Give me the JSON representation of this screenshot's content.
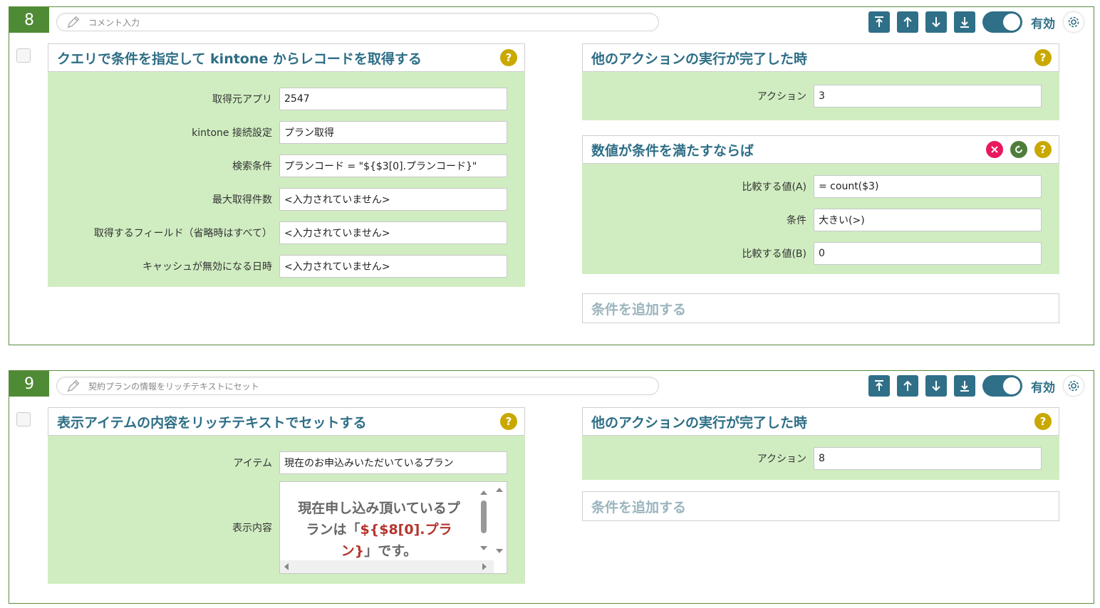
{
  "cards": [
    {
      "number": "8",
      "comment": "コメント入力",
      "status": "有効",
      "left": {
        "title": "クエリで条件を指定して kintone からレコードを取得する",
        "fields": [
          {
            "label": "取得元アプリ",
            "value": "2547"
          },
          {
            "label": "kintone 接続設定",
            "value": "プラン取得"
          },
          {
            "label": "検索条件",
            "value": "プランコード = \"${$3[0].プランコード}\""
          },
          {
            "label": "最大取得件数",
            "value": "<入力されていません>"
          },
          {
            "label": "取得するフィールド（省略時はすべて）",
            "value": "<入力されていません>"
          },
          {
            "label": "キャッシュが無効になる日時",
            "value": "<入力されていません>"
          }
        ]
      },
      "right": {
        "trigger_title": "他のアクションの実行が完了した時",
        "trigger_field": {
          "label": "アクション",
          "value": "3"
        },
        "condition_title": "数値が条件を満たすならば",
        "condition_fields": [
          {
            "label": "比較する値(A)",
            "value": "= count($3)"
          },
          {
            "label": "条件",
            "value": "大きい(>)"
          },
          {
            "label": "比較する値(B)",
            "value": "0"
          }
        ],
        "add_condition": "条件を追加する"
      }
    },
    {
      "number": "9",
      "comment": "契約プランの情報をリッチテキストにセット",
      "status": "有効",
      "left": {
        "title": "表示アイテムの内容をリッチテキストでセットする",
        "item_label": "アイテム",
        "item_value": "現在のお申込みいただいているプラン",
        "content_label": "表示内容",
        "content_line1": "現在申し込み頂いているプ",
        "content_line2_a": "ランは「",
        "content_line2_b": "${$8[0].プラ",
        "content_line3_a": "ン}",
        "content_line3_b": "」です。"
      },
      "right": {
        "trigger_title": "他のアクションの実行が完了した時",
        "trigger_field": {
          "label": "アクション",
          "value": "8"
        },
        "add_condition": "条件を追加する"
      }
    }
  ],
  "help_glyph": "?",
  "colors": {
    "accent": "#2f6f87",
    "green": "#4f8a35",
    "panel_bg": "#d0edc1",
    "help": "#c9a800"
  }
}
